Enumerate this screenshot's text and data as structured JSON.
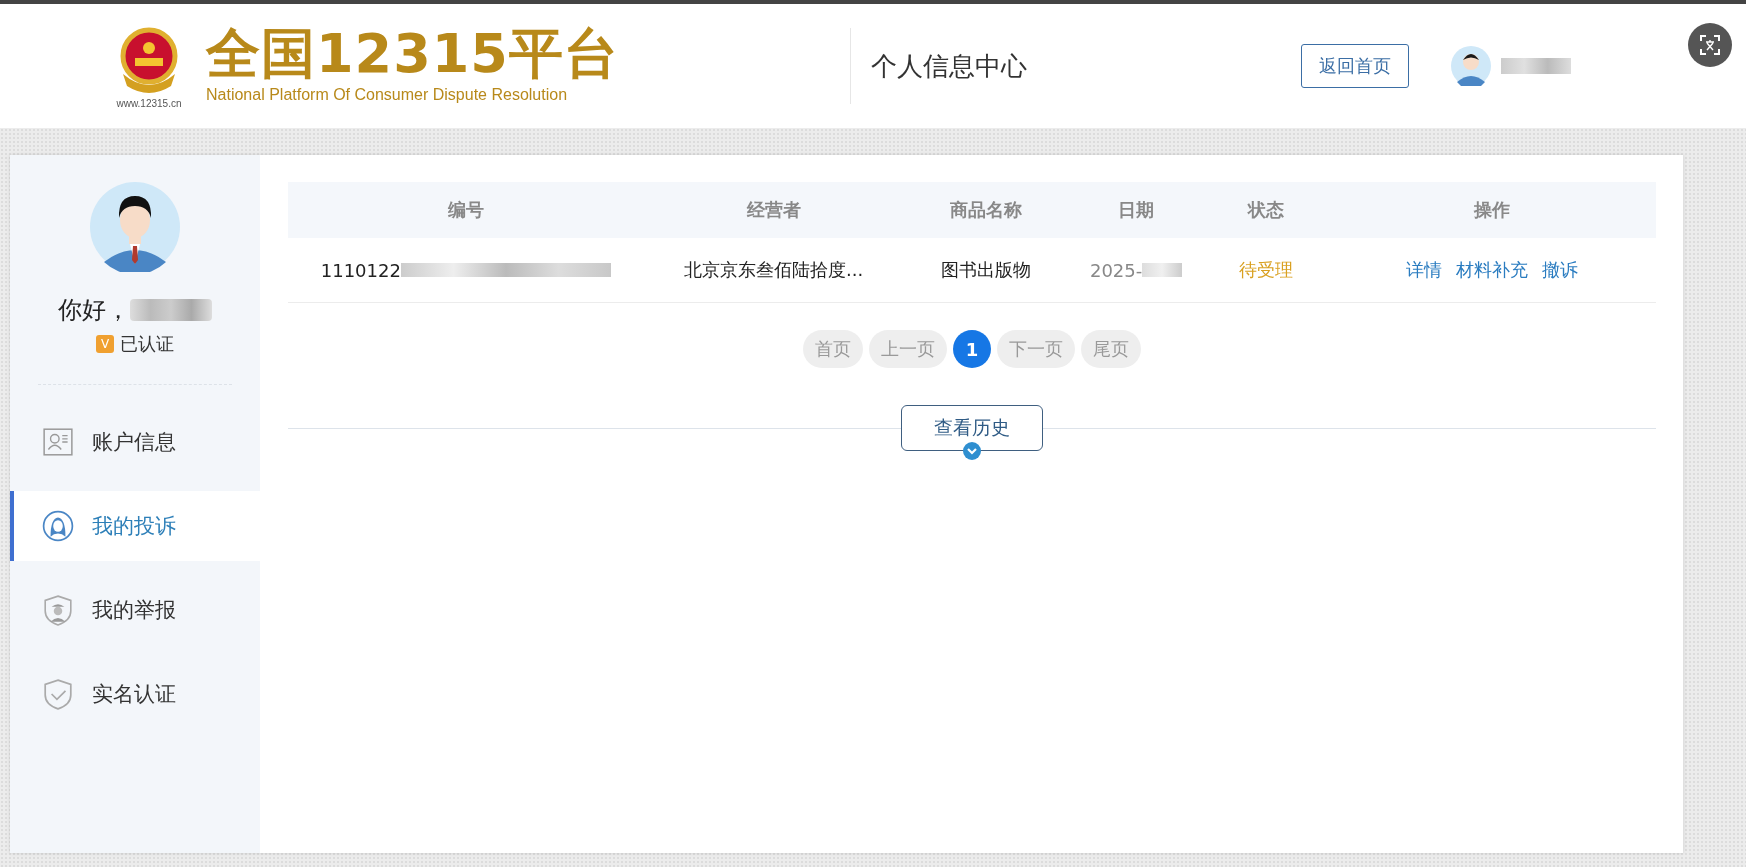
{
  "header": {
    "logo_title": "全国12315平台",
    "logo_subtitle": "National Platform Of Consumer Dispute Resolution",
    "logo_url": "www.12315.cn",
    "page_title": "个人信息中心",
    "home_button": "返回首页"
  },
  "profile": {
    "greeting": "你好，",
    "badge": "V",
    "verified": "已认证"
  },
  "sidebar": {
    "items": [
      {
        "label": "账户信息",
        "selected": false
      },
      {
        "label": "我的投诉",
        "selected": true
      },
      {
        "label": "我的举报",
        "selected": false
      },
      {
        "label": "实名认证",
        "selected": false
      }
    ]
  },
  "table": {
    "columns": [
      "编号",
      "经营者",
      "商品名称",
      "日期",
      "状态",
      "操作"
    ],
    "rows": [
      {
        "id": "1110122",
        "merchant": "北京京东叁佰陆拾度...",
        "product": "图书出版物",
        "date": "2025-",
        "status": "待受理",
        "actions": [
          "详情",
          "材料补充",
          "撤诉"
        ]
      }
    ]
  },
  "pagination": [
    {
      "label": "首页",
      "kind": "text",
      "selected": false,
      "disabled": true
    },
    {
      "label": "上一页",
      "kind": "text",
      "selected": false,
      "disabled": true
    },
    {
      "label": "1",
      "kind": "page",
      "selected": true,
      "disabled": false
    },
    {
      "label": "下一页",
      "kind": "text",
      "selected": false,
      "disabled": true
    },
    {
      "label": "尾页",
      "kind": "text",
      "selected": false,
      "disabled": true
    }
  ],
  "history_button": "查看历史"
}
